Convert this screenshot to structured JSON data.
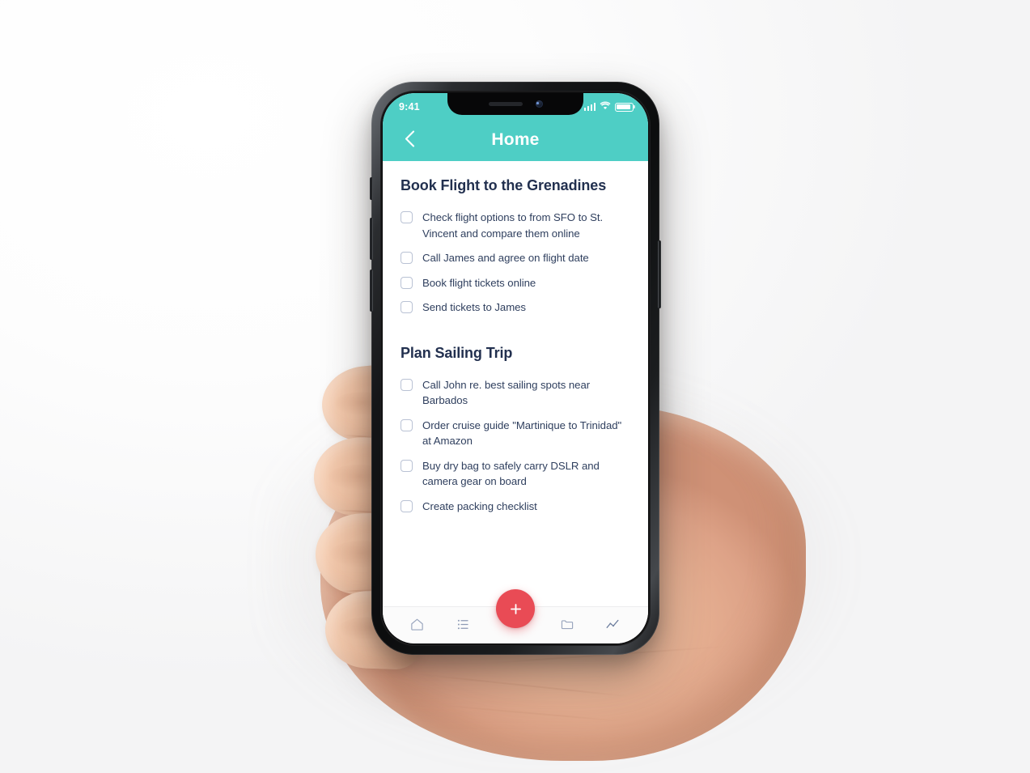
{
  "device": {
    "type": "smartphone-in-hand-mockup",
    "orientation": "portrait"
  },
  "status_bar": {
    "time": "9:41",
    "icons": [
      "signal-bars-icon",
      "wifi-icon",
      "battery-icon"
    ],
    "battery_level_percent": 92
  },
  "header": {
    "title": "Home",
    "back_icon": "chevron-left-icon",
    "background_color": "#4ECEC5",
    "text_color": "#FFFFFF"
  },
  "theme": {
    "accent_teal": "#4ECEC5",
    "fab_red": "#E94B55",
    "heading_navy": "#22304F",
    "body_navy": "#2F3F5E",
    "checkbox_border": "#B9C2D4",
    "screen_background": "#FFFFFF"
  },
  "sections": [
    {
      "title": "Book Flight to the Grenadines",
      "tasks": [
        {
          "text": "Check flight options to from SFO to St. Vincent and compare them online",
          "checked": false
        },
        {
          "text": "Call James and agree on flight date",
          "checked": false
        },
        {
          "text": "Book flight tickets online",
          "checked": false
        },
        {
          "text": "Send tickets to James",
          "checked": false
        }
      ]
    },
    {
      "title": "Plan Sailing Trip",
      "tasks": [
        {
          "text": "Call John re. best sailing spots near Barbados",
          "checked": false
        },
        {
          "text": "Order cruise guide \"Martinique to Trinidad\" at Amazon",
          "checked": false
        },
        {
          "text": "Buy dry bag to safely carry DSLR and camera gear on board",
          "checked": false
        },
        {
          "text": "Create packing checklist",
          "checked": false
        }
      ]
    }
  ],
  "bottom_nav": {
    "items": [
      {
        "icon": "home-icon",
        "name": "nav-home"
      },
      {
        "icon": "list-icon",
        "name": "nav-list"
      },
      {
        "icon": "folder-icon",
        "name": "nav-folder"
      },
      {
        "icon": "chart-line-icon",
        "name": "nav-stats"
      }
    ],
    "fab": {
      "icon": "plus-icon",
      "color": "#E94B55"
    }
  }
}
